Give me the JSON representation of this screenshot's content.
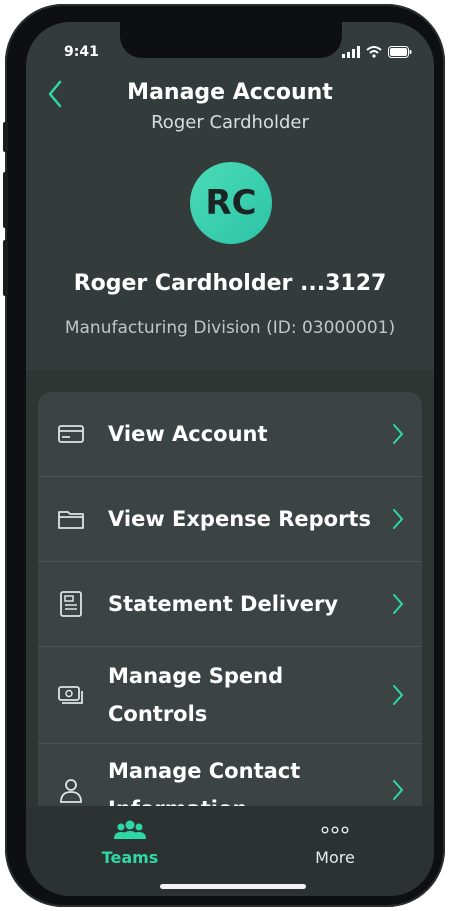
{
  "status_bar": {
    "time": "9:41"
  },
  "header": {
    "title": "Manage Account",
    "subtitle": "Roger Cardholder"
  },
  "profile": {
    "initials": "RC",
    "name": "Roger Cardholder ...3127",
    "division": "Manufacturing Division (ID: 03000001)"
  },
  "menu": {
    "items": [
      {
        "label": "View Account",
        "icon": "card-icon"
      },
      {
        "label": "View Expense Reports",
        "icon": "folder-icon"
      },
      {
        "label": "Statement Delivery",
        "icon": "document-icon"
      },
      {
        "label_line1": "Manage Spend",
        "label_line2": "Controls",
        "icon": "money-icon"
      },
      {
        "label_line1": "Manage Contact",
        "label_line2": "Information",
        "icon": "person-icon"
      }
    ]
  },
  "tabbar": {
    "tabs": [
      {
        "label": "Teams",
        "icon": "team-icon",
        "active": true
      },
      {
        "label": "More",
        "icon": "more-icon",
        "active": false
      }
    ]
  },
  "colors": {
    "accent": "#2fd7a6",
    "background": "#343c3b",
    "card": "#3b4443"
  }
}
